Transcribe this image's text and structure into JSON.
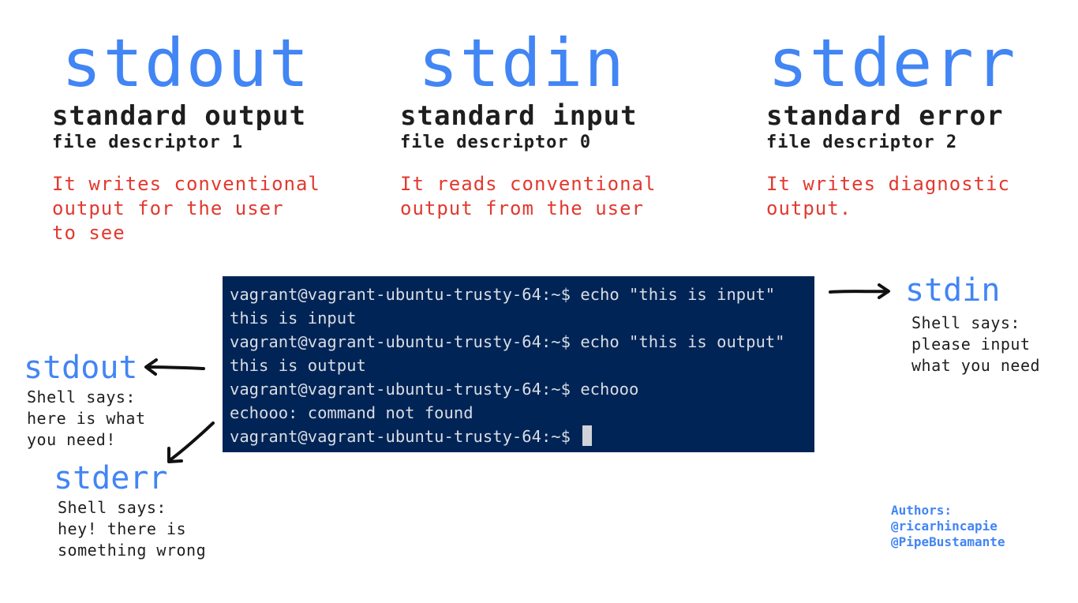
{
  "columns": [
    {
      "name": "stdout",
      "title": "standard output",
      "fd": "file descriptor 1",
      "description": "It writes conventional\noutput for the user\nto see"
    },
    {
      "name": "stdin",
      "title": "standard input",
      "fd": "file descriptor 0",
      "description": "It reads conventional\noutput from the user"
    },
    {
      "name": "stderr",
      "title": "standard error",
      "fd": "file descriptor 2",
      "description": "It writes diagnostic\noutput."
    }
  ],
  "terminal": {
    "lines": [
      "vagrant@vagrant-ubuntu-trusty-64:~$ echo \"this is input\"",
      "this is input",
      "vagrant@vagrant-ubuntu-trusty-64:~$ echo \"this is output\"",
      "this is output",
      "vagrant@vagrant-ubuntu-trusty-64:~$ echooo",
      "echooo: command not found",
      "vagrant@vagrant-ubuntu-trusty-64:~$ "
    ]
  },
  "callouts": {
    "stdin": {
      "label": "stdin",
      "text": "Shell says:\nplease input\nwhat you need"
    },
    "stdout": {
      "label": "stdout",
      "text": "Shell says:\nhere is what\nyou need!"
    },
    "stderr": {
      "label": "stderr",
      "text": "Shell says:\nhey! there is\nsomething wrong"
    }
  },
  "authors": "Authors:\n@ricarhincapie\n@PipeBustamante",
  "colors": {
    "accent_blue": "#4285f4",
    "description_red": "#e2392f",
    "terminal_bg": "#012456"
  }
}
